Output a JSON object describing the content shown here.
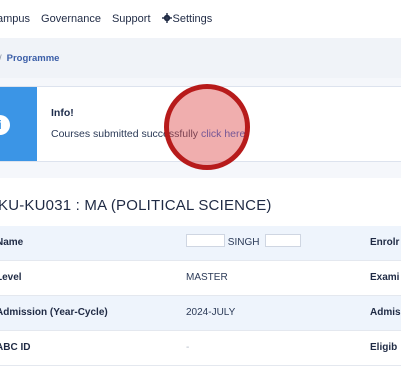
{
  "nav": {
    "items": [
      "ampus",
      "Governance",
      "Support",
      "Settings"
    ]
  },
  "breadcrumb": {
    "separator": "/",
    "current": "Programme"
  },
  "alert": {
    "title": "Info!",
    "message": "Courses submitted successfully",
    "link_label": "click here",
    "icon": "info-icon"
  },
  "programme": {
    "title": "KU-KU031 : MA (POLITICAL SCIENCE)",
    "title_visible": "ΚU-KU031 : MA (POLITICAL SCIENCE)"
  },
  "details": [
    {
      "label": "Name",
      "value": "SINGH",
      "right": "Enrolr"
    },
    {
      "label": "Level",
      "value": "MASTER",
      "right": "Exami"
    },
    {
      "label": "Admission (Year-Cycle)",
      "value": "2024-JULY",
      "right": "Admis"
    },
    {
      "label": "ABC ID",
      "value": "-",
      "right": "Eligib"
    }
  ],
  "colors": {
    "accent": "#3b95e6",
    "link": "#1f5fd1",
    "cursor_ring": "#b71b1b"
  }
}
